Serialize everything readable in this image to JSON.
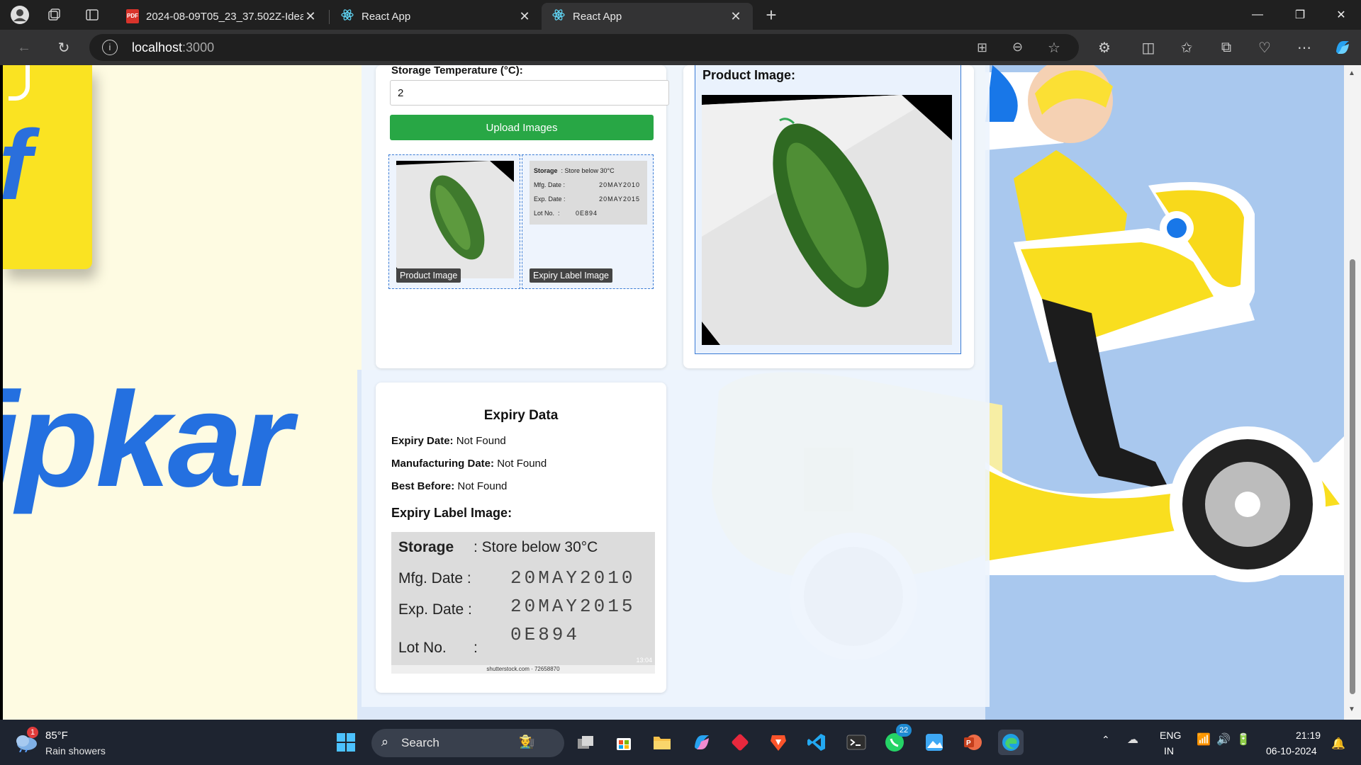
{
  "browser": {
    "tabs": [
      {
        "label": "2024-08-09T05_23_37.502Z-Idea",
        "icon": "pdf-icon"
      },
      {
        "label": "React App",
        "icon": "react-icon"
      },
      {
        "label": "React App",
        "icon": "react-icon",
        "active": true
      }
    ],
    "url_host": "localhost",
    "url_port": ":3000"
  },
  "upload_form": {
    "temperature_label": "Storage Temperature (°C):",
    "temperature_value": "2",
    "upload_button": "Upload Images",
    "thumb_product_caption": "Product Image",
    "thumb_label_caption": "Expiry Label Image"
  },
  "product_panel": {
    "title": "Product Image:"
  },
  "expiry_data": {
    "title": "Expiry Data",
    "expiry_date_label": "Expiry Date:",
    "expiry_date_value": "Not Found",
    "mfg_date_label": "Manufacturing Date:",
    "mfg_date_value": "Not Found",
    "best_before_label": "Best Before:",
    "best_before_value": "Not Found",
    "label_image_title": "Expiry Label Image:"
  },
  "label_image_text": {
    "storage_key": "Storage",
    "storage_value": ": Store below 30°C",
    "mfg_key": "Mfg. Date :",
    "mfg_value": "20MAY2010",
    "exp_key": "Exp. Date :",
    "exp_value": "20MAY2015",
    "lot_value": "0E894",
    "lot_key": "Lot No.",
    "lot_colon": ":",
    "watermark": "shutterstock.com · 72658870",
    "stamp": "13:04"
  },
  "taskbar": {
    "weather_badge": "1",
    "weather_temp": "85°F",
    "weather_desc": "Rain showers",
    "search_placeholder": "Search",
    "whatsapp_badge": "22",
    "lang_line1": "ENG",
    "lang_line2": "IN",
    "time": "21:19",
    "date": "06-10-2024"
  },
  "colors": {
    "upload_button": "#28a745",
    "flipkart_blue": "#2470e0",
    "flipkart_yellow": "#fae322",
    "accent_border": "#3a7bd5"
  }
}
